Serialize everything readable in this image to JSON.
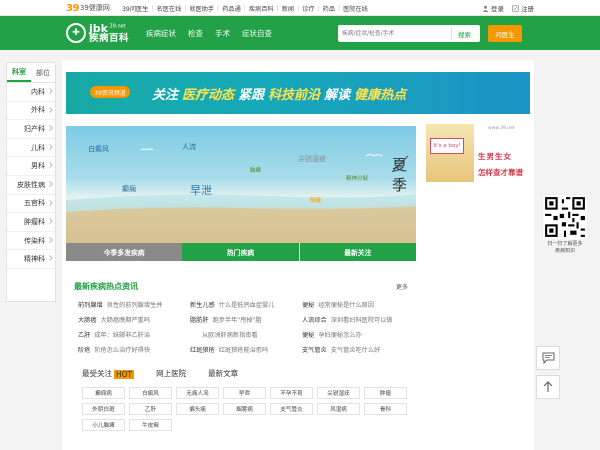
{
  "topbar": {
    "logo_num": "39",
    "logo_text": "39健康网",
    "nav": [
      "39问医生",
      "名医在线",
      "就医助手",
      "药品通",
      "疾病百科",
      "新闻",
      "诊疗",
      "药品",
      "医院在线"
    ],
    "login": "登录",
    "register": "注册"
  },
  "header": {
    "logo_en": "jbk",
    "logo_domain": ".39.net",
    "logo_cn": "疾病百科",
    "nav": [
      "疾病症状",
      "检查",
      "手术",
      "症状自查"
    ],
    "search_placeholder": "疾病/症状/检查/手术",
    "search_button": "搜索",
    "ask_button": "问医生"
  },
  "sidebar": {
    "tabs": [
      "科室",
      "部位"
    ],
    "items": [
      "内科",
      "外科",
      "妇产科",
      "儿科",
      "男科",
      "皮肤性病",
      "五官科",
      "肿瘤科",
      "传染科",
      "精神科"
    ]
  },
  "banner": {
    "badge": "39资讯频道",
    "seg1_a": "关注",
    "seg1_b": "医疗动态",
    "seg2_a": "紧跟",
    "seg2_b": "科技前沿",
    "seg3_a": "解读",
    "seg3_b": "健康热点"
  },
  "scene": {
    "labels": [
      "白癜风",
      "人流",
      "癫痫",
      "早泄",
      "脑瘫",
      "尖锐湿疣",
      "精神分裂",
      "阳痿"
    ],
    "season": "夏季"
  },
  "subtabs": [
    "今季多发疾病",
    "热门疾病",
    "最新关注"
  ],
  "news": {
    "title": "最新疾病热点资讯",
    "more": "更多",
    "rows": [
      [
        {
          "k": "前列腺增",
          "d": "良性的前列腺增生并"
        },
        {
          "k": "新生儿感",
          "d": "什么是低钙血症婴儿"
        },
        {
          "k": "便秘",
          "d": "经常便秘是什么原因"
        }
      ],
      [
        {
          "k": "大肠癌",
          "d": "大肠癌晚期严重吗"
        },
        {
          "k": "脂肪肝",
          "d": "跑步半年\"甩掉\"脂"
        },
        {
          "k": "人流综合",
          "d": "深圳看妇科医院可以做"
        }
      ],
      [
        {
          "k": "乙肝",
          "d": "成年：妹脚非乙肝治"
        },
        {
          "k": "",
          "d": "从欧洲肝病新指南看"
        },
        {
          "k": "便秘",
          "d": "孕妇便秘怎么办"
        }
      ],
      [
        {
          "k": "阶疮",
          "d": "阶疮怎么治疗好得快"
        },
        {
          "k": "红斑狼疮",
          "d": "红斑狼疮能治愈吗"
        },
        {
          "k": "支气管炎",
          "d": "支气管炎吃什么好"
        }
      ]
    ]
  },
  "recommend": {
    "tabs": [
      "最受关注",
      "网上医院",
      "最新文章"
    ],
    "hot": "HOT",
    "chips": [
      "癫痫病",
      "白癜风",
      "无痛人流",
      "早泄",
      "不孕不育",
      "尖锐湿疣",
      "肿瘤",
      "外阴白斑",
      "乙肝",
      "偏头痛",
      "烟雾病",
      "支气管炎",
      "风湿病",
      "骨科",
      "小儿脑瘫",
      "牛皮癣"
    ]
  },
  "ad": {
    "url": "www.39.net",
    "boy_text": "It's a boy!",
    "line1": "生男生女",
    "line2": "怎样查才靠谱"
  },
  "qr": {
    "caption1": "扫一扫了解更多",
    "caption2": "疾病知识"
  },
  "colors": {
    "brand_green": "#22a146",
    "accent_orange": "#f39800"
  }
}
